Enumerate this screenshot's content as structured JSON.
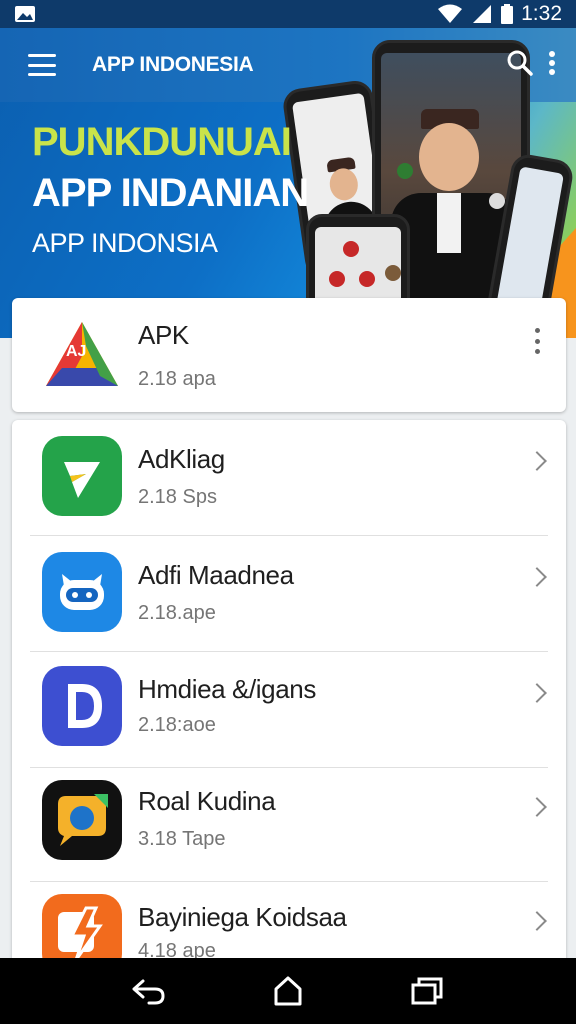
{
  "status_bar": {
    "time": "1:32",
    "icons": [
      "image-icon",
      "wifi-icon",
      "signal-icon",
      "battery-icon"
    ]
  },
  "app_bar": {
    "title": "APP INDONESIA",
    "icons": [
      "menu-icon",
      "search-icon",
      "more-vert-icon"
    ]
  },
  "banner": {
    "line1": "PUNKDUNUAI",
    "line2": "APP INDANIAN",
    "line3": "APP INDONSIA"
  },
  "featured": {
    "name": "APK",
    "size": "2.18 apa",
    "icon": "aj-triangle-icon"
  },
  "apps": [
    {
      "name": "AdKliag",
      "size": "2.18 Sps",
      "icon": "green-check-icon",
      "color": "#24a34a"
    },
    {
      "name": "Adfi Maadnea",
      "size": "2.18.ape",
      "icon": "blue-robot-icon",
      "color": "#1e88e5"
    },
    {
      "name": "Hmdiea &/igans",
      "size": "2.18:aoe",
      "icon": "letter-d-icon",
      "color": "#3d4fd1"
    },
    {
      "name": "Roal Kudina",
      "size": "3.18 Tape",
      "icon": "chat-bubble-icon",
      "color": "#111111"
    },
    {
      "name": "Bayiniega Koidsaa",
      "size": "4.18 ape",
      "icon": "orange-bolt-icon",
      "color": "#f26b1d"
    }
  ],
  "colors": {
    "status_bar": "#0e3a6a",
    "app_bar": "#1565b4",
    "banner_green": "#c9e34a",
    "accent_orange": "#f7941d"
  },
  "nav_bar": {
    "icons": [
      "back-icon",
      "home-icon",
      "recents-icon"
    ]
  }
}
